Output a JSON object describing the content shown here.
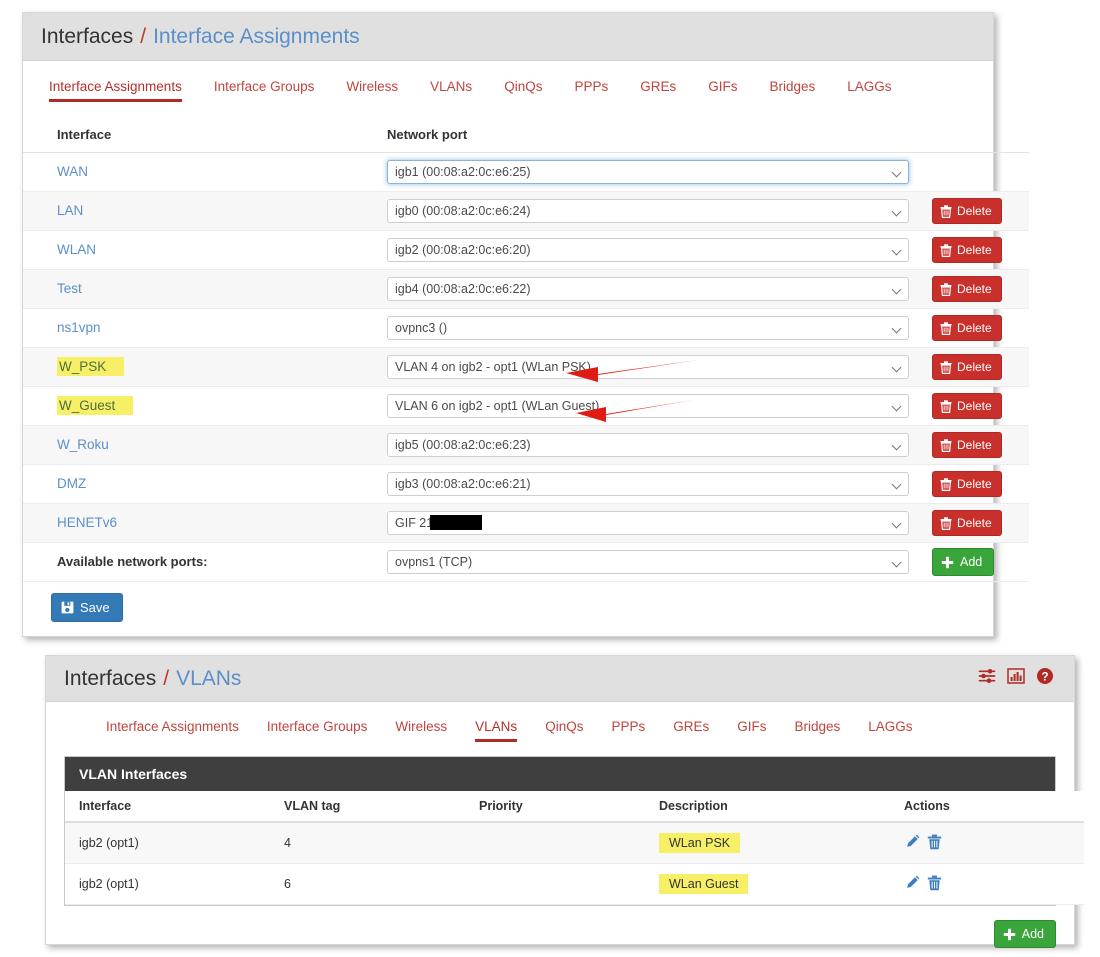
{
  "panel1": {
    "breadcrumb": {
      "root": "Interfaces",
      "separator": "/",
      "current": "Interface Assignments"
    },
    "tabs": [
      {
        "label": "Interface Assignments",
        "active": true
      },
      {
        "label": "Interface Groups",
        "active": false
      },
      {
        "label": "Wireless",
        "active": false
      },
      {
        "label": "VLANs",
        "active": false
      },
      {
        "label": "QinQs",
        "active": false
      },
      {
        "label": "PPPs",
        "active": false
      },
      {
        "label": "GREs",
        "active": false
      },
      {
        "label": "GIFs",
        "active": false
      },
      {
        "label": "Bridges",
        "active": false
      },
      {
        "label": "LAGGs",
        "active": false
      }
    ],
    "columns": {
      "interface": "Interface",
      "network_port": "Network port"
    },
    "rows": [
      {
        "interface": "WAN",
        "port": "igb1 (00:08:a2:0c:e6:25)",
        "delete": "",
        "highlighted": false,
        "focused": true,
        "has_delete": false,
        "redacted": false
      },
      {
        "interface": "LAN",
        "port": "igb0 (00:08:a2:0c:e6:24)",
        "delete": "Delete",
        "highlighted": false,
        "focused": false,
        "has_delete": true,
        "redacted": false
      },
      {
        "interface": "WLAN",
        "port": "igb2 (00:08:a2:0c:e6:20)",
        "delete": "Delete",
        "highlighted": false,
        "focused": false,
        "has_delete": true,
        "redacted": false
      },
      {
        "interface": "Test",
        "port": "igb4 (00:08:a2:0c:e6:22)",
        "delete": "Delete",
        "highlighted": false,
        "focused": false,
        "has_delete": true,
        "redacted": false
      },
      {
        "interface": "ns1vpn",
        "port": "ovpnc3 ()",
        "delete": "Delete",
        "highlighted": false,
        "focused": false,
        "has_delete": true,
        "redacted": false
      },
      {
        "interface": "W_PSK",
        "port": "VLAN 4 on igb2 - opt1 (WLan PSK)",
        "delete": "Delete",
        "highlighted": true,
        "focused": false,
        "has_delete": true,
        "redacted": false
      },
      {
        "interface": "W_Guest",
        "port": "VLAN 6 on igb2 - opt1 (WLan Guest)",
        "delete": "Delete",
        "highlighted": true,
        "focused": false,
        "has_delete": true,
        "redacted": false
      },
      {
        "interface": "W_Roku",
        "port": "igb5 (00:08:a2:0c:e6:23)",
        "delete": "Delete",
        "highlighted": false,
        "focused": false,
        "has_delete": true,
        "redacted": false
      },
      {
        "interface": "DMZ",
        "port": "igb3 (00:08:a2:0c:e6:21)",
        "delete": "Delete",
        "highlighted": false,
        "focused": false,
        "has_delete": true,
        "redacted": false
      },
      {
        "interface": "HENETv6",
        "port": "GIF 216          (HE)",
        "delete": "Delete",
        "highlighted": false,
        "focused": false,
        "has_delete": true,
        "redacted": true
      }
    ],
    "available_ports_label": "Available network ports:",
    "available_ports_value": "ovpns1 (TCP)",
    "add_label": "Add",
    "save_label": "Save"
  },
  "panel2": {
    "breadcrumb": {
      "root": "Interfaces",
      "separator": "/",
      "current": "VLANs"
    },
    "header_icons": [
      {
        "name": "sliders-icon",
        "title": ""
      },
      {
        "name": "bar-chart-icon",
        "title": ""
      },
      {
        "name": "help-icon",
        "title": ""
      }
    ],
    "tabs": [
      {
        "label": "Interface Assignments",
        "active": false
      },
      {
        "label": "Interface Groups",
        "active": false
      },
      {
        "label": "Wireless",
        "active": false
      },
      {
        "label": "VLANs",
        "active": true
      },
      {
        "label": "QinQs",
        "active": false
      },
      {
        "label": "PPPs",
        "active": false
      },
      {
        "label": "GREs",
        "active": false
      },
      {
        "label": "GIFs",
        "active": false
      },
      {
        "label": "Bridges",
        "active": false
      },
      {
        "label": "LAGGs",
        "active": false
      }
    ],
    "card_title": "VLAN Interfaces",
    "columns": [
      "Interface",
      "VLAN tag",
      "Priority",
      "Description",
      "Actions"
    ],
    "rows": [
      {
        "interface": "igb2 (opt1)",
        "vlan_tag": "4",
        "priority": "",
        "description": "WLan PSK",
        "highlighted": true
      },
      {
        "interface": "igb2 (opt1)",
        "vlan_tag": "6",
        "priority": "",
        "description": "WLan Guest",
        "highlighted": true
      }
    ],
    "add_label": "Add"
  },
  "colors": {
    "accent_red": "#b02b26",
    "link_blue": "#5b8fc9",
    "highlight_yellow": "#f7f066",
    "delete_red": "#c9302c",
    "add_green": "#3aa53a",
    "save_blue": "#337ab7",
    "arrow_red": "#e01b14"
  },
  "annotations": {
    "arrows": [
      {
        "name": "arrow-to-vlan4",
        "points_at": "VLAN 4 on igb2 - opt1 (WLan PSK)"
      },
      {
        "name": "arrow-to-vlan6",
        "points_at": "VLAN 6 on igb2 - opt1 (WLan Guest)"
      }
    ]
  }
}
